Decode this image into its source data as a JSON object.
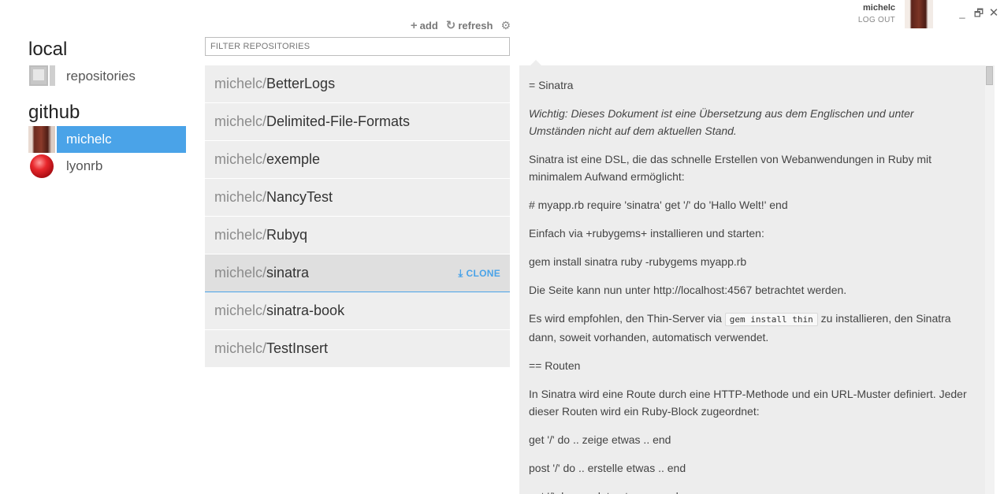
{
  "user": {
    "name": "michelc",
    "logout_label": "LOG OUT"
  },
  "window": {
    "minimize": "_",
    "restore": "🗗",
    "close": "✕"
  },
  "sidebar": {
    "local_title": "local",
    "local_items": [
      {
        "label": "repositories",
        "icon": "computer-icon"
      }
    ],
    "github_title": "github",
    "github_items": [
      {
        "label": "michelc",
        "icon": "avatar",
        "selected": true
      },
      {
        "label": "lyonrb",
        "icon": "ruby-icon",
        "selected": false
      }
    ]
  },
  "toolbar": {
    "add_label": "add",
    "refresh_label": "refresh"
  },
  "filter": {
    "placeholder": "FILTER REPOSITORIES",
    "value": ""
  },
  "repos": [
    {
      "owner": "michelc/",
      "name": "BetterLogs"
    },
    {
      "owner": "michelc/",
      "name": "Delimited-File-Formats"
    },
    {
      "owner": "michelc/",
      "name": "exemple"
    },
    {
      "owner": "michelc/",
      "name": "NancyTest"
    },
    {
      "owner": "michelc/",
      "name": "Rubyq"
    },
    {
      "owner": "michelc/",
      "name": "sinatra",
      "selected": true,
      "action": "CLONE"
    },
    {
      "owner": "michelc/",
      "name": "sinatra-book"
    },
    {
      "owner": "michelc/",
      "name": "TestInsert"
    }
  ],
  "readme": {
    "p1": "= Sinatra",
    "p2": "Wichtig: Dieses Dokument ist eine Übersetzung aus dem Englischen und unter Umständen nicht auf dem aktuellen Stand.",
    "p3": "Sinatra ist eine DSL, die das schnelle Erstellen von Webanwendungen in Ruby mit minimalem Aufwand ermöglicht:",
    "p4": "# myapp.rb require 'sinatra' get '/' do 'Hallo Welt!' end",
    "p5": "Einfach via +rubygems+ installieren und starten:",
    "p6": "gem install sinatra ruby -rubygems myapp.rb",
    "p7": "Die Seite kann nun unter http://localhost:4567 betrachtet werden.",
    "p8_before": "Es wird empfohlen, den Thin-Server via ",
    "p8_code": "gem install thin",
    "p8_after": " zu installieren, den Sinatra dann, soweit vorhanden, automatisch verwendet.",
    "p9": "== Routen",
    "p10": "In Sinatra wird eine Route durch eine HTTP-Methode und ein URL-Muster definiert. Jeder dieser Routen wird ein Ruby-Block zugeordnet:",
    "p11": "get '/' do .. zeige etwas .. end",
    "p12": "post '/' do .. erstelle etwas .. end",
    "p13": "put '/' do .. update etwas .. end"
  },
  "colors": {
    "accent": "#4aa3e8",
    "panel": "#ededed"
  }
}
